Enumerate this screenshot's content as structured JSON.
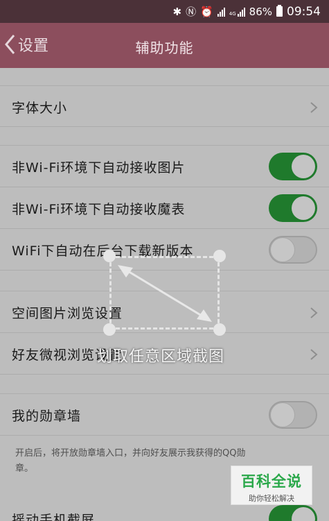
{
  "status_bar": {
    "battery": "86%",
    "time": "09:54",
    "network_label": "4G"
  },
  "title_bar": {
    "back_label": "设置",
    "title": "辅助功能"
  },
  "settings": [
    {
      "label": "字体大小",
      "control": "chevron"
    },
    {
      "label": "非Wi-Fi环境下自动接收图片",
      "control": "toggle",
      "state": "on"
    },
    {
      "label": "非Wi-Fi环境下自动接收魔表",
      "control": "toggle",
      "state": "on"
    },
    {
      "label": "WiFi下自动在后台下载新版本",
      "control": "toggle",
      "state": "off"
    },
    {
      "label": "空间图片浏览设置",
      "control": "chevron"
    },
    {
      "label": "好友微视浏览设置",
      "control": "chevron"
    },
    {
      "label": "我的勋章墙",
      "control": "toggle",
      "state": "off"
    },
    {
      "label": "摇动手机截屏",
      "control": "toggle",
      "state": "on"
    }
  ],
  "medal_note": "开启后，将开放勋章墙入口，并向好友展示我获得的QQ勋章。",
  "overlay": {
    "caption": "划取任意区域截图"
  },
  "watermark": {
    "title": "百科全说",
    "subtitle": "助你轻松解决"
  },
  "colors": {
    "title_bar": "#8c4e5d",
    "status_bar": "#4b3138",
    "toggle_on": "#1f7a2c",
    "background": "#bdbdbd"
  }
}
